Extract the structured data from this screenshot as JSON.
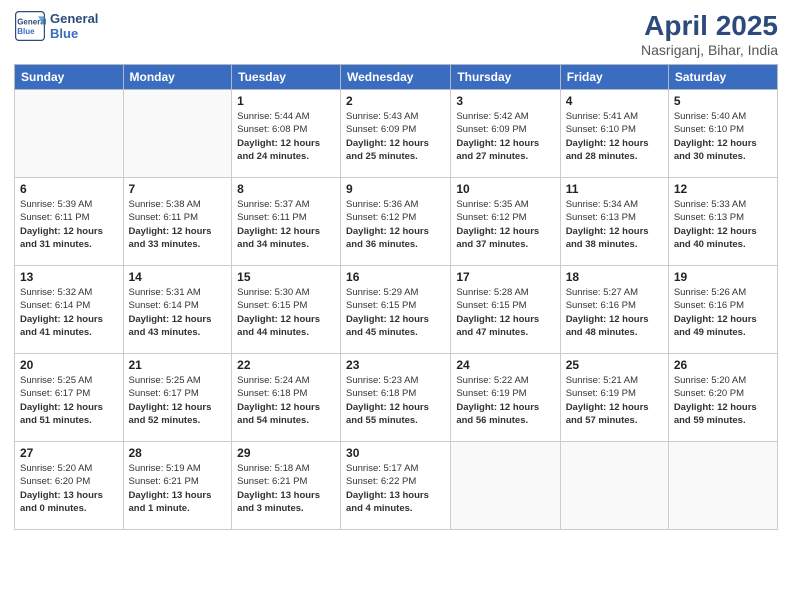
{
  "header": {
    "logo_line1": "General",
    "logo_line2": "Blue",
    "title": "April 2025",
    "subtitle": "Nasriganj, Bihar, India"
  },
  "weekdays": [
    "Sunday",
    "Monday",
    "Tuesday",
    "Wednesday",
    "Thursday",
    "Friday",
    "Saturday"
  ],
  "weeks": [
    [
      {
        "date": "",
        "info": ""
      },
      {
        "date": "",
        "info": ""
      },
      {
        "date": "1",
        "info": "Sunrise: 5:44 AM\nSunset: 6:08 PM\nDaylight: 12 hours and 24 minutes."
      },
      {
        "date": "2",
        "info": "Sunrise: 5:43 AM\nSunset: 6:09 PM\nDaylight: 12 hours and 25 minutes."
      },
      {
        "date": "3",
        "info": "Sunrise: 5:42 AM\nSunset: 6:09 PM\nDaylight: 12 hours and 27 minutes."
      },
      {
        "date": "4",
        "info": "Sunrise: 5:41 AM\nSunset: 6:10 PM\nDaylight: 12 hours and 28 minutes."
      },
      {
        "date": "5",
        "info": "Sunrise: 5:40 AM\nSunset: 6:10 PM\nDaylight: 12 hours and 30 minutes."
      }
    ],
    [
      {
        "date": "6",
        "info": "Sunrise: 5:39 AM\nSunset: 6:11 PM\nDaylight: 12 hours and 31 minutes."
      },
      {
        "date": "7",
        "info": "Sunrise: 5:38 AM\nSunset: 6:11 PM\nDaylight: 12 hours and 33 minutes."
      },
      {
        "date": "8",
        "info": "Sunrise: 5:37 AM\nSunset: 6:11 PM\nDaylight: 12 hours and 34 minutes."
      },
      {
        "date": "9",
        "info": "Sunrise: 5:36 AM\nSunset: 6:12 PM\nDaylight: 12 hours and 36 minutes."
      },
      {
        "date": "10",
        "info": "Sunrise: 5:35 AM\nSunset: 6:12 PM\nDaylight: 12 hours and 37 minutes."
      },
      {
        "date": "11",
        "info": "Sunrise: 5:34 AM\nSunset: 6:13 PM\nDaylight: 12 hours and 38 minutes."
      },
      {
        "date": "12",
        "info": "Sunrise: 5:33 AM\nSunset: 6:13 PM\nDaylight: 12 hours and 40 minutes."
      }
    ],
    [
      {
        "date": "13",
        "info": "Sunrise: 5:32 AM\nSunset: 6:14 PM\nDaylight: 12 hours and 41 minutes."
      },
      {
        "date": "14",
        "info": "Sunrise: 5:31 AM\nSunset: 6:14 PM\nDaylight: 12 hours and 43 minutes."
      },
      {
        "date": "15",
        "info": "Sunrise: 5:30 AM\nSunset: 6:15 PM\nDaylight: 12 hours and 44 minutes."
      },
      {
        "date": "16",
        "info": "Sunrise: 5:29 AM\nSunset: 6:15 PM\nDaylight: 12 hours and 45 minutes."
      },
      {
        "date": "17",
        "info": "Sunrise: 5:28 AM\nSunset: 6:15 PM\nDaylight: 12 hours and 47 minutes."
      },
      {
        "date": "18",
        "info": "Sunrise: 5:27 AM\nSunset: 6:16 PM\nDaylight: 12 hours and 48 minutes."
      },
      {
        "date": "19",
        "info": "Sunrise: 5:26 AM\nSunset: 6:16 PM\nDaylight: 12 hours and 49 minutes."
      }
    ],
    [
      {
        "date": "20",
        "info": "Sunrise: 5:25 AM\nSunset: 6:17 PM\nDaylight: 12 hours and 51 minutes."
      },
      {
        "date": "21",
        "info": "Sunrise: 5:25 AM\nSunset: 6:17 PM\nDaylight: 12 hours and 52 minutes."
      },
      {
        "date": "22",
        "info": "Sunrise: 5:24 AM\nSunset: 6:18 PM\nDaylight: 12 hours and 54 minutes."
      },
      {
        "date": "23",
        "info": "Sunrise: 5:23 AM\nSunset: 6:18 PM\nDaylight: 12 hours and 55 minutes."
      },
      {
        "date": "24",
        "info": "Sunrise: 5:22 AM\nSunset: 6:19 PM\nDaylight: 12 hours and 56 minutes."
      },
      {
        "date": "25",
        "info": "Sunrise: 5:21 AM\nSunset: 6:19 PM\nDaylight: 12 hours and 57 minutes."
      },
      {
        "date": "26",
        "info": "Sunrise: 5:20 AM\nSunset: 6:20 PM\nDaylight: 12 hours and 59 minutes."
      }
    ],
    [
      {
        "date": "27",
        "info": "Sunrise: 5:20 AM\nSunset: 6:20 PM\nDaylight: 13 hours and 0 minutes."
      },
      {
        "date": "28",
        "info": "Sunrise: 5:19 AM\nSunset: 6:21 PM\nDaylight: 13 hours and 1 minute."
      },
      {
        "date": "29",
        "info": "Sunrise: 5:18 AM\nSunset: 6:21 PM\nDaylight: 13 hours and 3 minutes."
      },
      {
        "date": "30",
        "info": "Sunrise: 5:17 AM\nSunset: 6:22 PM\nDaylight: 13 hours and 4 minutes."
      },
      {
        "date": "",
        "info": ""
      },
      {
        "date": "",
        "info": ""
      },
      {
        "date": "",
        "info": ""
      }
    ]
  ]
}
